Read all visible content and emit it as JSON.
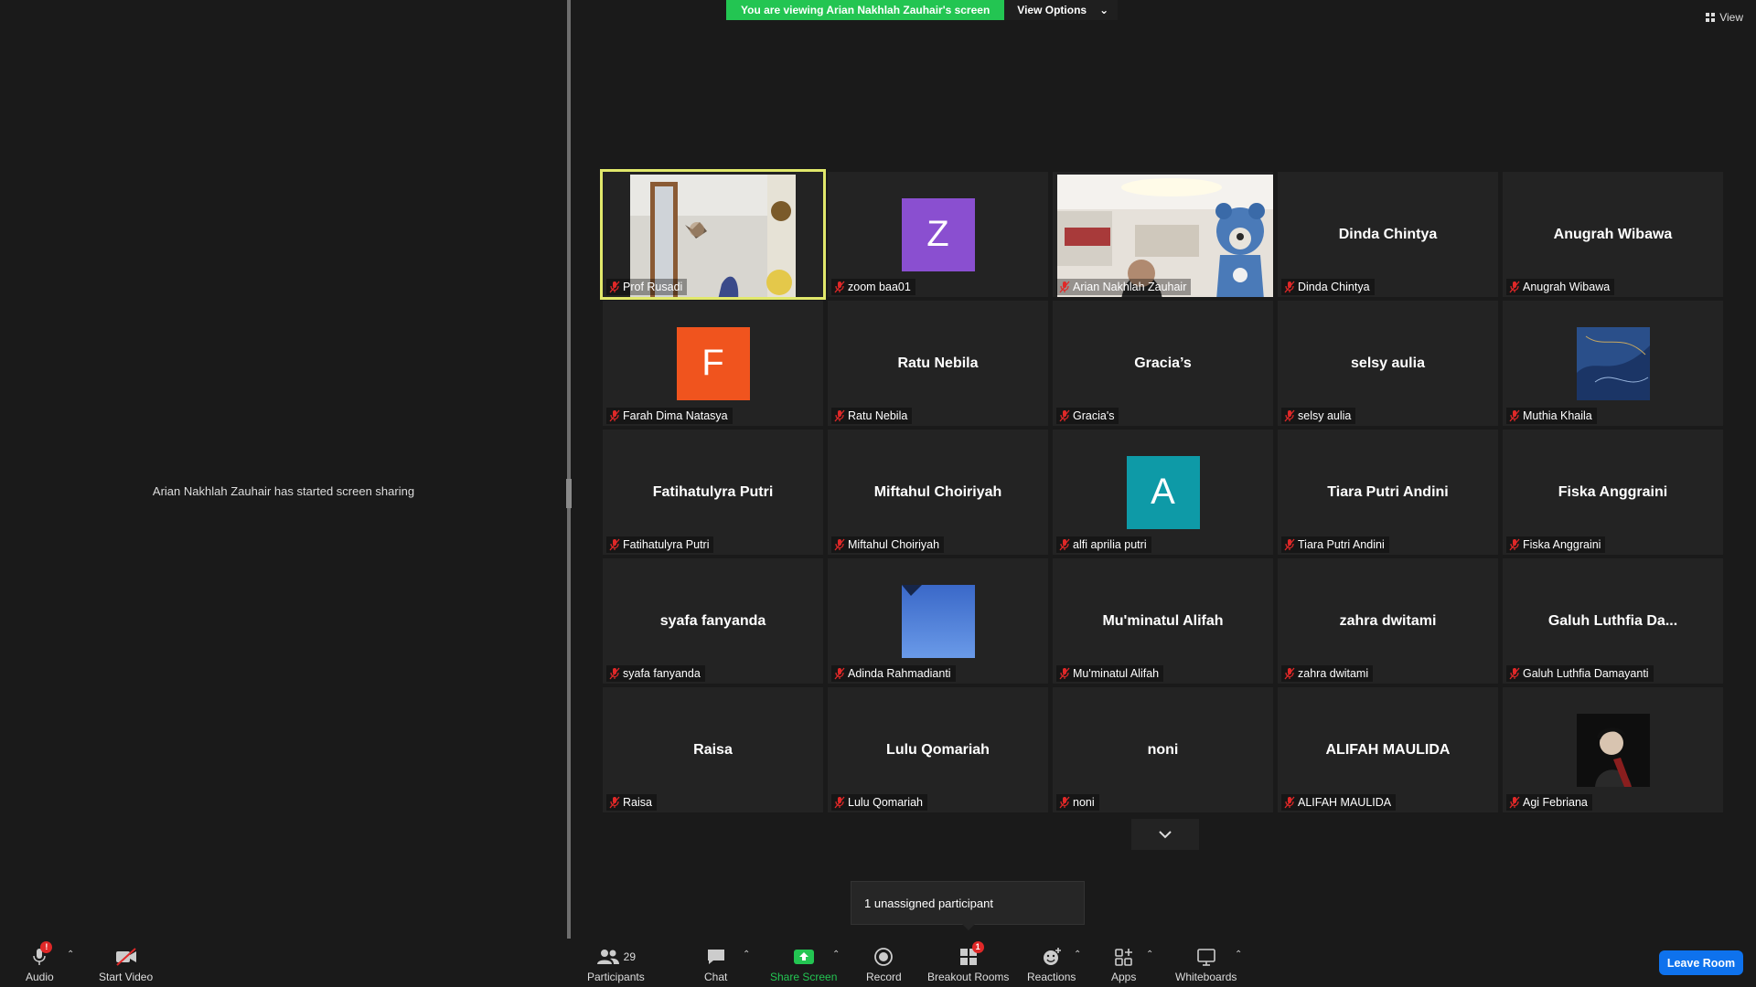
{
  "banner": {
    "viewing_text": "You are viewing Arian Nakhlah Zauhair's screen",
    "view_options_label": "View Options"
  },
  "view_button_label": "View",
  "share_message": "Arian Nakhlah Zauhair has started screen sharing",
  "participants": [
    {
      "display": "video",
      "label": "Prof Rusadi"
    },
    {
      "display": "letter",
      "letter": "Z",
      "color": "#8a4fd0",
      "label": "zoom baa01"
    },
    {
      "display": "video",
      "label": "Arian Nakhlah Zauhair"
    },
    {
      "display": "name",
      "big_name": "Dinda Chintya",
      "label": "Dinda Chintya"
    },
    {
      "display": "name",
      "big_name": "Anugrah Wibawa",
      "label": "Anugrah Wibawa"
    },
    {
      "display": "letter",
      "letter": "F",
      "color": "#f0541e",
      "label": "Farah Dima Natasya"
    },
    {
      "display": "name",
      "big_name": "Ratu Nebila",
      "label": "Ratu Nebila"
    },
    {
      "display": "name",
      "big_name": "Gracia’s",
      "label": "Gracia's"
    },
    {
      "display": "name",
      "big_name": "selsy aulia",
      "label": "selsy aulia"
    },
    {
      "display": "photo",
      "label": "Muthia Khaila"
    },
    {
      "display": "name",
      "big_name": "Fatihatulyra Putri",
      "label": "Fatihatulyra Putri"
    },
    {
      "display": "name",
      "big_name": "Miftahul Choiriyah",
      "label": "Miftahul Choiriyah"
    },
    {
      "display": "letter",
      "letter": "A",
      "color": "#0e9aa7",
      "label": "alfi aprilia putri"
    },
    {
      "display": "name",
      "big_name": "Tiara Putri Andini",
      "label": "Tiara Putri Andini"
    },
    {
      "display": "name",
      "big_name": "Fiska Anggraini",
      "label": "Fiska Anggraini"
    },
    {
      "display": "name",
      "big_name": "syafa fanyanda",
      "label": "syafa fanyanda"
    },
    {
      "display": "photo",
      "label": "Adinda Rahmadianti"
    },
    {
      "display": "name",
      "big_name": "Mu'minatul Alifah",
      "label": "Mu'minatul Alifah"
    },
    {
      "display": "name",
      "big_name": "zahra dwitami",
      "label": "zahra dwitami"
    },
    {
      "display": "name",
      "big_name": "Galuh Luthfia Da...",
      "label": "Galuh Luthfia Damayanti"
    },
    {
      "display": "name",
      "big_name": "Raisa",
      "label": "Raisa"
    },
    {
      "display": "name",
      "big_name": "Lulu  Qomariah",
      "label": "Lulu  Qomariah"
    },
    {
      "display": "name",
      "big_name": "noni",
      "label": "noni"
    },
    {
      "display": "name",
      "big_name": "ALIFAH MAULIDA",
      "label": "ALIFAH MAULIDA"
    },
    {
      "display": "photo",
      "label": "Agi Febriana"
    }
  ],
  "tooltip": "1 unassigned participant",
  "toolbar": {
    "audio": {
      "label": "Audio",
      "badge": "!"
    },
    "video": {
      "label": "Start Video"
    },
    "participants": {
      "label": "Participants",
      "count": "29"
    },
    "chat": {
      "label": "Chat"
    },
    "share": {
      "label": "Share Screen"
    },
    "record": {
      "label": "Record"
    },
    "breakout": {
      "label": "Breakout Rooms",
      "badge": "1"
    },
    "reactions": {
      "label": "Reactions"
    },
    "apps": {
      "label": "Apps"
    },
    "whiteboards": {
      "label": "Whiteboards"
    },
    "leave": {
      "label": "Leave Room"
    }
  },
  "colors": {
    "accent_green": "#23c552",
    "active_speaker": "#e1e86b",
    "leave_blue": "#0e72ed",
    "mic_muted_red": "#e02828"
  }
}
